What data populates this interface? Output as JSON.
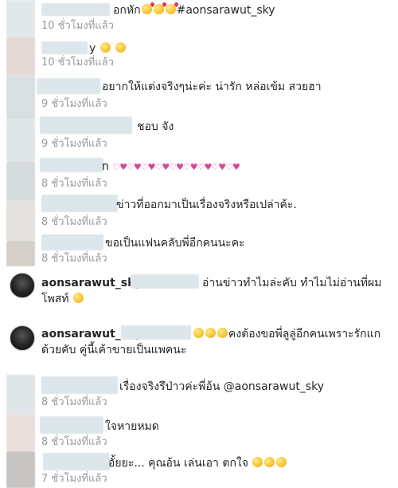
{
  "comments": [
    {
      "text": "อกหัก",
      "tag": "#aonsarawut_sky",
      "time": "10 ชั่วโมงที่แล้ว"
    },
    {
      "text": "",
      "time": "10 ชั่วโมงที่แล้ว"
    },
    {
      "text": "อยากให้แต่งจริงๆน่ะค่ะ น่ารัก หล่อเข้ม สวยฮา",
      "time": "9 ชั่วโมงที่แล้ว"
    },
    {
      "text": "ชอบ จัง",
      "time": "9 ชั่วโมงที่แล้ว"
    },
    {
      "text": "",
      "time": "8 ชั่วโมงที่แล้ว"
    },
    {
      "text": "ข่าวที่ออกมาเป็นเรื่องจริงหรือเปล่าค้ะ.",
      "time": "8 ชั่วโมงที่แล้ว"
    },
    {
      "text": "ขอเป็นแฟนคลับพี่อีกคนนะคะ",
      "time": "8 ชั่วโมงที่แล้ว"
    }
  ],
  "replies": [
    {
      "user": "aonsarawut_sky",
      "line1": "อ่านข่าวทำไมล่ะคับ ทำไมไม่อ่านที่ผม",
      "line2": "โพสท์"
    },
    {
      "user": "aonsarawut_sky",
      "line1": "คงต้องขอพี่ลูลู่อีกคนเพราะรักแก",
      "line2": "ด้วยคับ คู่นี้เค้าขายเป็นแพคนะ"
    }
  ],
  "comments2": [
    {
      "text": "เรื่องจริงรึป่าวค่ะพี่อ้น",
      "mention": "@aonsarawut_sky",
      "time": "8 ชั่วโมงที่แล้ว"
    },
    {
      "text": "ใจหายหมด",
      "time": "8 ชั่วโมงที่แล้ว"
    },
    {
      "text": "อั้ยยะ... คุณอ้น เล่นเอา ตกใจ",
      "time": "7 ชั่วโมงที่แล้ว"
    }
  ]
}
